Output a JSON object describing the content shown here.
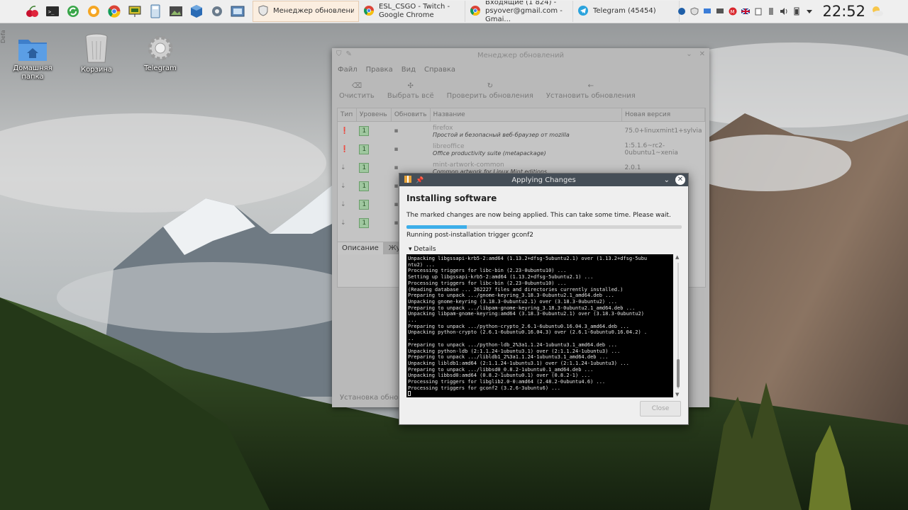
{
  "taskbar": {
    "left_handle_text": "Defa",
    "launchers": [
      "cherry-app-icon",
      "terminal-icon",
      "sync-icon",
      "chat-icon",
      "chrome-icon",
      "presentation-icon",
      "calculator-icon",
      "image-viewer-icon",
      "virtualbox-icon",
      "settings-icon",
      "screenshot-icon"
    ],
    "tasks": [
      {
        "title": "Менеджер обновлений",
        "active": true
      },
      {
        "title": "ESL_CSGO - Twitch - Google Chrome",
        "active": false
      },
      {
        "title": "Входящие (1 824) - psyover@gmail.com - Gmai...",
        "active": false
      },
      {
        "title": "Telegram (45454)",
        "active": false
      }
    ],
    "clock": "22:52"
  },
  "desktop": {
    "icons": [
      {
        "label": "Домашняя папка"
      },
      {
        "label": "Корзина"
      },
      {
        "label": "Telegram"
      }
    ]
  },
  "update_manager": {
    "title": "Менеджер обновлений",
    "menu": [
      "Файл",
      "Правка",
      "Вид",
      "Справка"
    ],
    "toolbar": [
      "Очистить",
      "Выбрать всё",
      "Проверить обновления",
      "Установить обновления"
    ],
    "columns": [
      "Тип",
      "Уровень",
      "Обновить",
      "Название",
      "Новая версия"
    ],
    "rows": [
      {
        "level": "1",
        "name": "firefox",
        "desc": "Простой и безопасный веб-браузер от mozilla",
        "version": "75.0+linuxmint1+sylvia"
      },
      {
        "level": "1",
        "name": "libreoffice",
        "desc": "Office productivity suite (metapackage)",
        "version": "1:5.1.6~rc2-0ubuntu1~xenia"
      },
      {
        "level": "1",
        "name": "mint-artwork-common",
        "desc": "Common artwork for Linux Mint editions",
        "version": "2.0.1"
      },
      {
        "level": "1",
        "name": "",
        "desc": "",
        "version": ""
      },
      {
        "level": "1",
        "name": "",
        "desc": "",
        "version": ""
      },
      {
        "level": "1",
        "name": "",
        "desc": "",
        "version": ""
      }
    ],
    "tabs": [
      "Описание",
      "Журнал"
    ],
    "status": "Установка обновлений"
  },
  "dialog": {
    "title": "Applying Changes",
    "heading": "Installing software",
    "message": "The marked changes are now being applied. This can take some time. Please wait.",
    "progress": 0.22,
    "substatus": "Running post-installation trigger gconf2",
    "details_label": "Details",
    "log": [
      "Unpacking libgssapi-krb5-2:amd64 (1.13.2+dfsg-5ubuntu2.1) over (1.13.2+dfsg-5ubu",
      "ntu2) ...",
      "Processing triggers for libc-bin (2.23-0ubuntu10) ...",
      "Setting up libgssapi-krb5-2:amd64 (1.13.2+dfsg-5ubuntu2.1) ...",
      "Processing triggers for libc-bin (2.23-0ubuntu10) ...",
      "(Reading database ... 262227 files and directories currently installed.)",
      "Preparing to unpack .../gnome-keyring_3.18.3-0ubuntu2.1_amd64.deb ...",
      "Unpacking gnome-keyring (3.18.3-0ubuntu2.1) over (3.18.3-0ubuntu2) ...",
      "Preparing to unpack .../libpam-gnome-keyring_3.18.3-0ubuntu2.1_amd64.deb ...",
      "Unpacking libpam-gnome-keyring:amd64 (3.18.3-0ubuntu2.1) over (3.18.3-0ubuntu2)",
      "...",
      "Preparing to unpack .../python-crypto_2.6.1-6ubuntu0.16.04.3_amd64.deb ...",
      "Unpacking python-crypto (2.6.1-6ubuntu0.16.04.3) over (2.6.1-6ubuntu0.16.04.2) .",
      "..",
      "Preparing to unpack .../python-ldb_2%3a1.1.24-1ubuntu3.1_amd64.deb ...",
      "Unpacking python-ldb (2:1.1.24-1ubuntu3.1) over (2:1.1.24-1ubuntu3) ...",
      "Preparing to unpack .../libldb1_2%3a1.1.24-1ubuntu3.1_amd64.deb ...",
      "Unpacking libldb1:amd64 (2:1.1.24-1ubuntu3.1) over (2:1.1.24-1ubuntu3) ...",
      "Preparing to unpack .../libbsd0_0.8.2-1ubuntu0.1_amd64.deb ...",
      "Unpacking libbsd0:amd64 (0.8.2-1ubuntu0.1) over (0.8.2-1) ...",
      "Processing triggers for libglib2.0-0:amd64 (2.48.2-0ubuntu4.6) ...",
      "Processing triggers for gconf2 (3.2.6-3ubuntu6) ..."
    ],
    "close_label": "Close"
  }
}
